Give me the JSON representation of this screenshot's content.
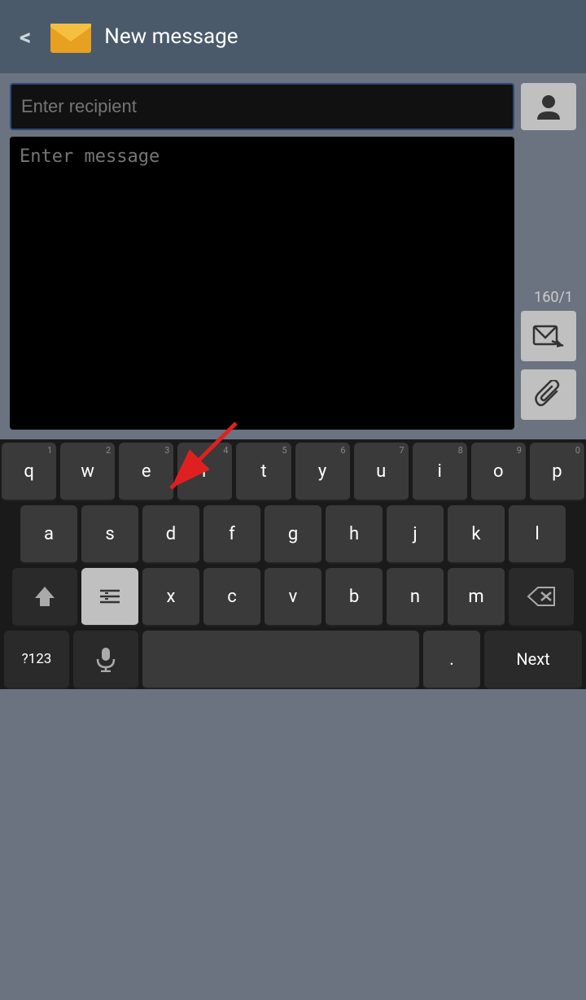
{
  "header": {
    "back_label": "<",
    "title": "New message",
    "icon_alt": "mail-icon"
  },
  "compose": {
    "recipient_placeholder": "Enter recipient",
    "message_placeholder": "Enter message",
    "char_count": "160/1"
  },
  "keyboard": {
    "rows": [
      [
        {
          "label": "q",
          "hint": "1"
        },
        {
          "label": "w",
          "hint": "2"
        },
        {
          "label": "e",
          "hint": "3"
        },
        {
          "label": "r",
          "hint": "4"
        },
        {
          "label": "t",
          "hint": "5"
        },
        {
          "label": "y",
          "hint": "6"
        },
        {
          "label": "u",
          "hint": "7"
        },
        {
          "label": "i",
          "hint": "8"
        },
        {
          "label": "o",
          "hint": "9"
        },
        {
          "label": "p",
          "hint": "0"
        }
      ],
      [
        {
          "label": "a",
          "hint": ""
        },
        {
          "label": "s",
          "hint": ""
        },
        {
          "label": "d",
          "hint": ""
        },
        {
          "label": "f",
          "hint": ""
        },
        {
          "label": "g",
          "hint": ""
        },
        {
          "label": "h",
          "hint": ""
        },
        {
          "label": "j",
          "hint": ""
        },
        {
          "label": "k",
          "hint": ""
        },
        {
          "label": "l",
          "hint": ""
        }
      ],
      [
        {
          "label": "shift",
          "hint": ""
        },
        {
          "label": "highlighted",
          "hint": ""
        },
        {
          "label": "x",
          "hint": ""
        },
        {
          "label": "c",
          "hint": ""
        },
        {
          "label": "v",
          "hint": ""
        },
        {
          "label": "b",
          "hint": ""
        },
        {
          "label": "n",
          "hint": ""
        },
        {
          "label": "m",
          "hint": ""
        },
        {
          "label": "backspace",
          "hint": ""
        }
      ],
      [
        {
          "label": "?123",
          "hint": ""
        },
        {
          "label": "mic",
          "hint": ""
        },
        {
          "label": "space",
          "hint": ""
        },
        {
          "label": ".",
          "hint": ""
        },
        {
          "label": "Next",
          "hint": ""
        }
      ]
    ]
  }
}
